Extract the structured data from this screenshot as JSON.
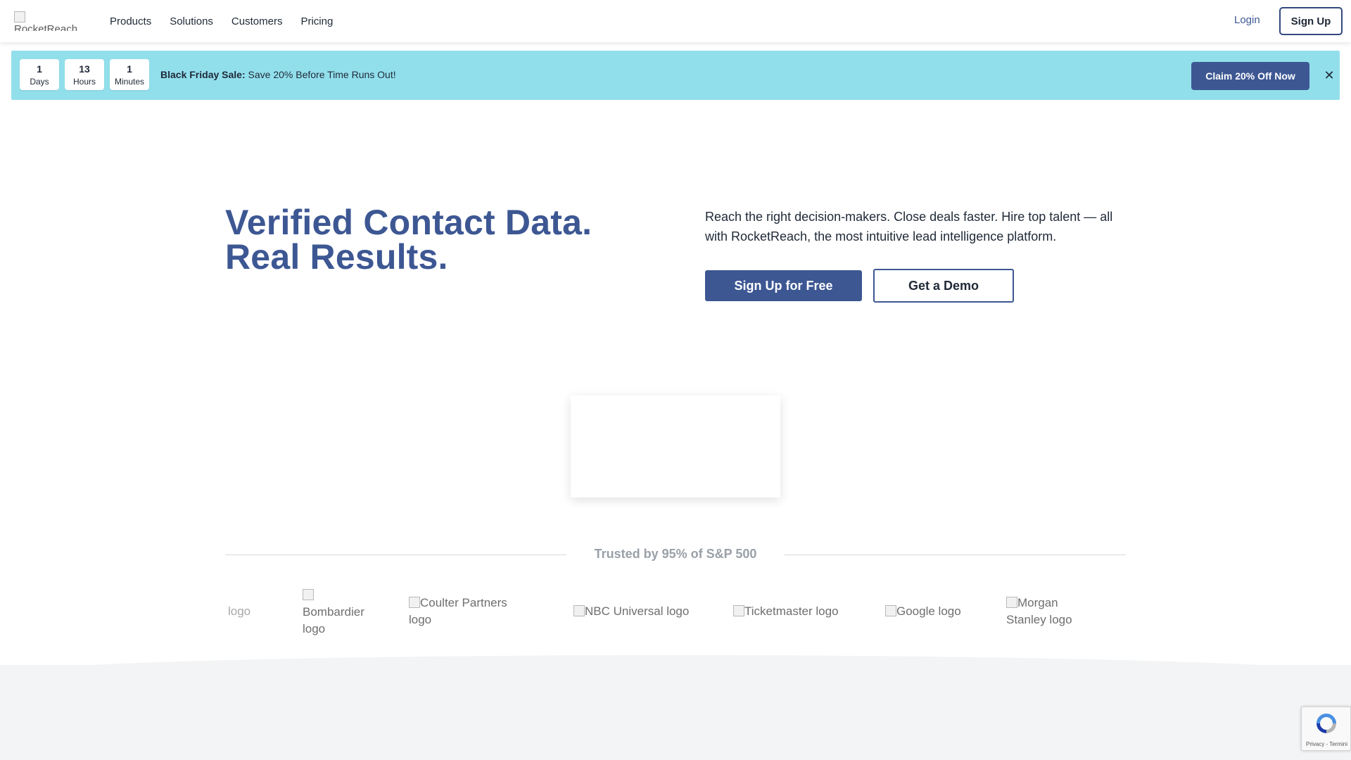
{
  "header": {
    "logo_alt": "RocketReach",
    "nav": [
      "Products",
      "Solutions",
      "Customers",
      "Pricing"
    ],
    "login_label": "Login",
    "signup_label": "Sign Up"
  },
  "banner": {
    "timer": [
      {
        "value": "1",
        "unit": "Days"
      },
      {
        "value": "13",
        "unit": "Hours"
      },
      {
        "value": "1",
        "unit": "Minutes"
      }
    ],
    "title": "Black Friday Sale:",
    "message": "Save 20% Before Time Runs Out!",
    "cta_label": "Claim 20% Off Now",
    "close_symbol": "✕"
  },
  "hero": {
    "title_line1": "Verified Contact Data.",
    "title_line2": "Real Results.",
    "description": "Reach the right decision-makers. Close deals faster. Hire top talent — all with RocketReach, the most intuitive lead intelligence platform.",
    "primary_cta": "Sign Up for Free",
    "secondary_cta": "Get a Demo"
  },
  "trusted": {
    "heading": "Trusted by 95% of S&P 500",
    "logos": [
      "logo",
      "Bombardier logo",
      "Coulter Partners logo",
      "NBC Universal logo",
      "Ticketmaster logo",
      "Google logo",
      "Morgan Stanley logo"
    ]
  },
  "recaptcha": {
    "text": "Privacy - Termini"
  },
  "colors": {
    "brand": "#3d5793",
    "banner_bg": "#92dfec",
    "muted": "#9aa0a8"
  }
}
